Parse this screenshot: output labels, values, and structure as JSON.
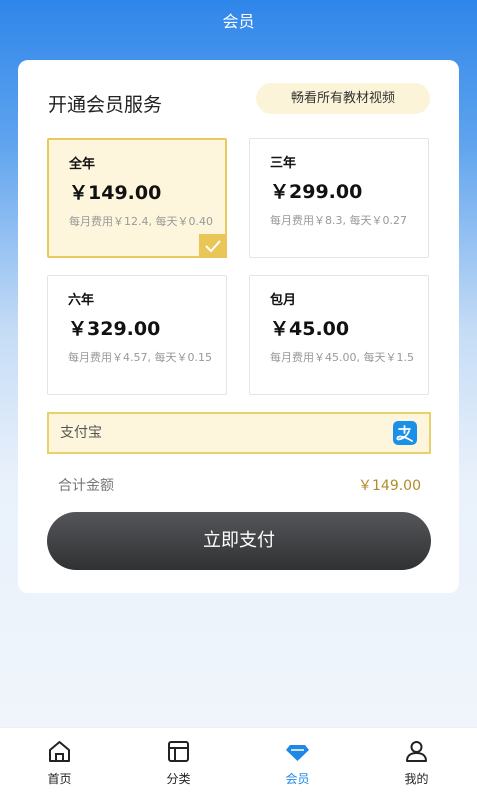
{
  "header": {
    "title": "会员"
  },
  "card": {
    "title": "开通会员服务",
    "tag": "畅看所有教材视频",
    "plans": [
      {
        "name": "全年",
        "price": "￥149.00",
        "desc": "每月费用￥12.4, 每天￥0.40",
        "selected": true
      },
      {
        "name": "三年",
        "price": "￥299.00",
        "desc": "每月费用￥8.3, 每天￥0.27",
        "selected": false
      },
      {
        "name": "六年",
        "price": "￥329.00",
        "desc": "每月费用￥4.57, 每天￥0.15",
        "selected": false
      },
      {
        "name": "包月",
        "price": "￥45.00",
        "desc": "每月费用￥45.00, 每天￥1.5",
        "selected": false
      }
    ],
    "payment": {
      "label": "支付宝",
      "icon": "alipay-icon"
    },
    "total": {
      "label": "合计金额",
      "value": "￥149.00"
    },
    "pay_button": "立即支付"
  },
  "tabbar": {
    "items": [
      {
        "label": "首页",
        "icon": "home-icon",
        "active": false
      },
      {
        "label": "分类",
        "icon": "category-icon",
        "active": false
      },
      {
        "label": "会员",
        "icon": "diamond-icon",
        "active": true
      },
      {
        "label": "我的",
        "icon": "user-icon",
        "active": false
      }
    ]
  },
  "colors": {
    "accent_gold": "#e8c95c",
    "active_blue": "#1f88e6",
    "header_blue": "#2f86ea"
  }
}
